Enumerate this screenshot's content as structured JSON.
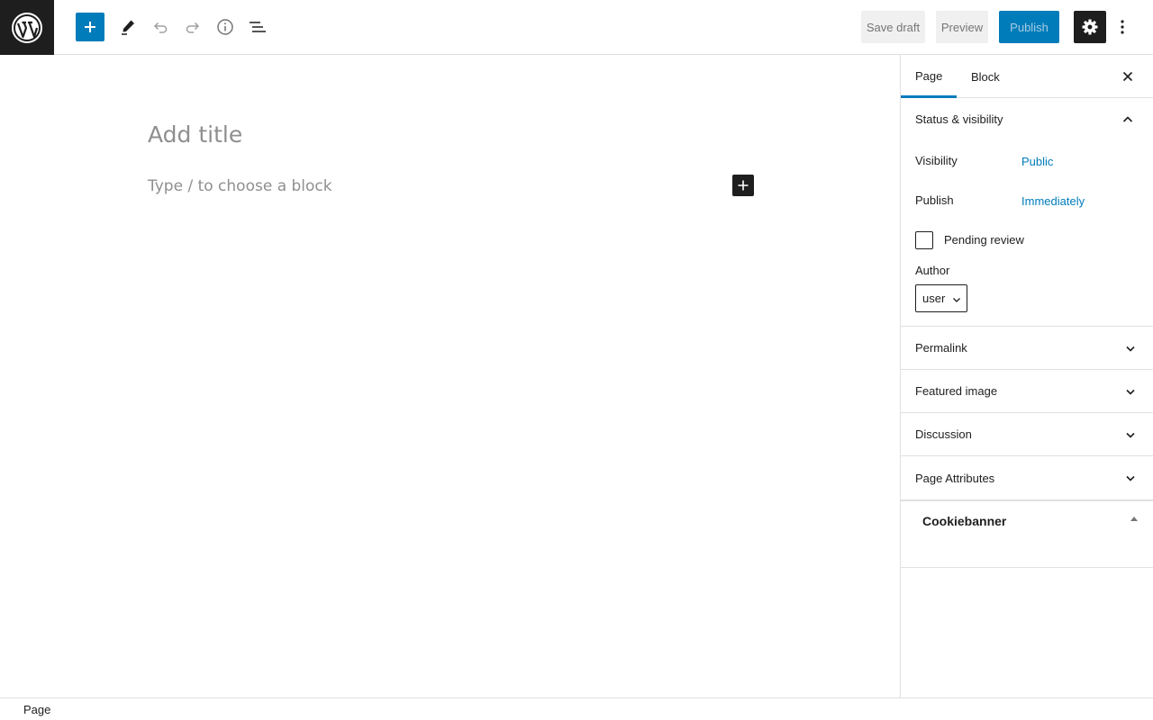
{
  "header": {
    "save_draft": "Save draft",
    "preview": "Preview",
    "publish": "Publish"
  },
  "editor": {
    "title_placeholder": "Add title",
    "block_placeholder": "Type / to choose a block"
  },
  "sidebar": {
    "tabs": [
      {
        "label": "Page",
        "active": true
      },
      {
        "label": "Block",
        "active": false
      }
    ],
    "status": {
      "title": "Status & visibility",
      "visibility_label": "Visibility",
      "visibility_value": "Public",
      "publish_label": "Publish",
      "publish_value": "Immediately",
      "pending_label": "Pending review",
      "pending_checked": false,
      "author_label": "Author",
      "author_value": "user"
    },
    "panels": [
      {
        "label": "Permalink"
      },
      {
        "label": "Featured image"
      },
      {
        "label": "Discussion"
      },
      {
        "label": "Page Attributes"
      }
    ],
    "cookiebanner": "Cookiebanner"
  },
  "footer": {
    "breadcrumb": "Page"
  },
  "colors": {
    "accent": "#007cba",
    "dark": "#1e1e1e",
    "border": "#e0e0e0"
  }
}
